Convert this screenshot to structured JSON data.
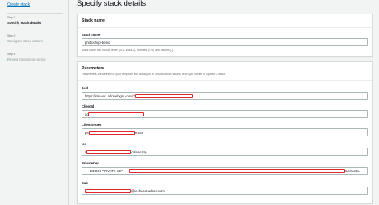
{
  "sidebar": {
    "create_link": "Create stack",
    "steps": [
      {
        "num": "Step 1",
        "title": "Specify stack details"
      },
      {
        "num": "Step 2",
        "title": "Configure stack options"
      },
      {
        "num": "Step 3",
        "title": "Review photoshop-demo"
      }
    ]
  },
  "page_title": "Specify stack details",
  "stack_name_panel": {
    "header": "Stack name",
    "label": "Stack name",
    "value": "photoshop-demo",
    "hint": "Stack name can include letters (A-Z and a-z), numbers (0-9), and dashes (-)."
  },
  "parameters_panel": {
    "header": "Parameters",
    "description": "Parameters are defined in your template and allow you to input custom values when you create or update a stack.",
    "fields": [
      {
        "label": "Aud",
        "prefix": "https://ims-na1.adobelogin.com/c/",
        "suffix": ""
      },
      {
        "label": "ClientId",
        "prefix": "ac",
        "suffix": ""
      },
      {
        "label": "ClientSecret",
        "prefix": "p8",
        "suffix": "R6SY"
      },
      {
        "label": "Iss",
        "prefix": "0",
        "suffix": "AdobeOrg"
      },
      {
        "label": "PrivateKey",
        "prefix": "-----BEGIN PRIVATE KEY-----",
        "suffix": "0L5mUQL"
      },
      {
        "label": "Sub",
        "prefix": "",
        "suffix": "@techacct.adobe.com"
      }
    ]
  }
}
